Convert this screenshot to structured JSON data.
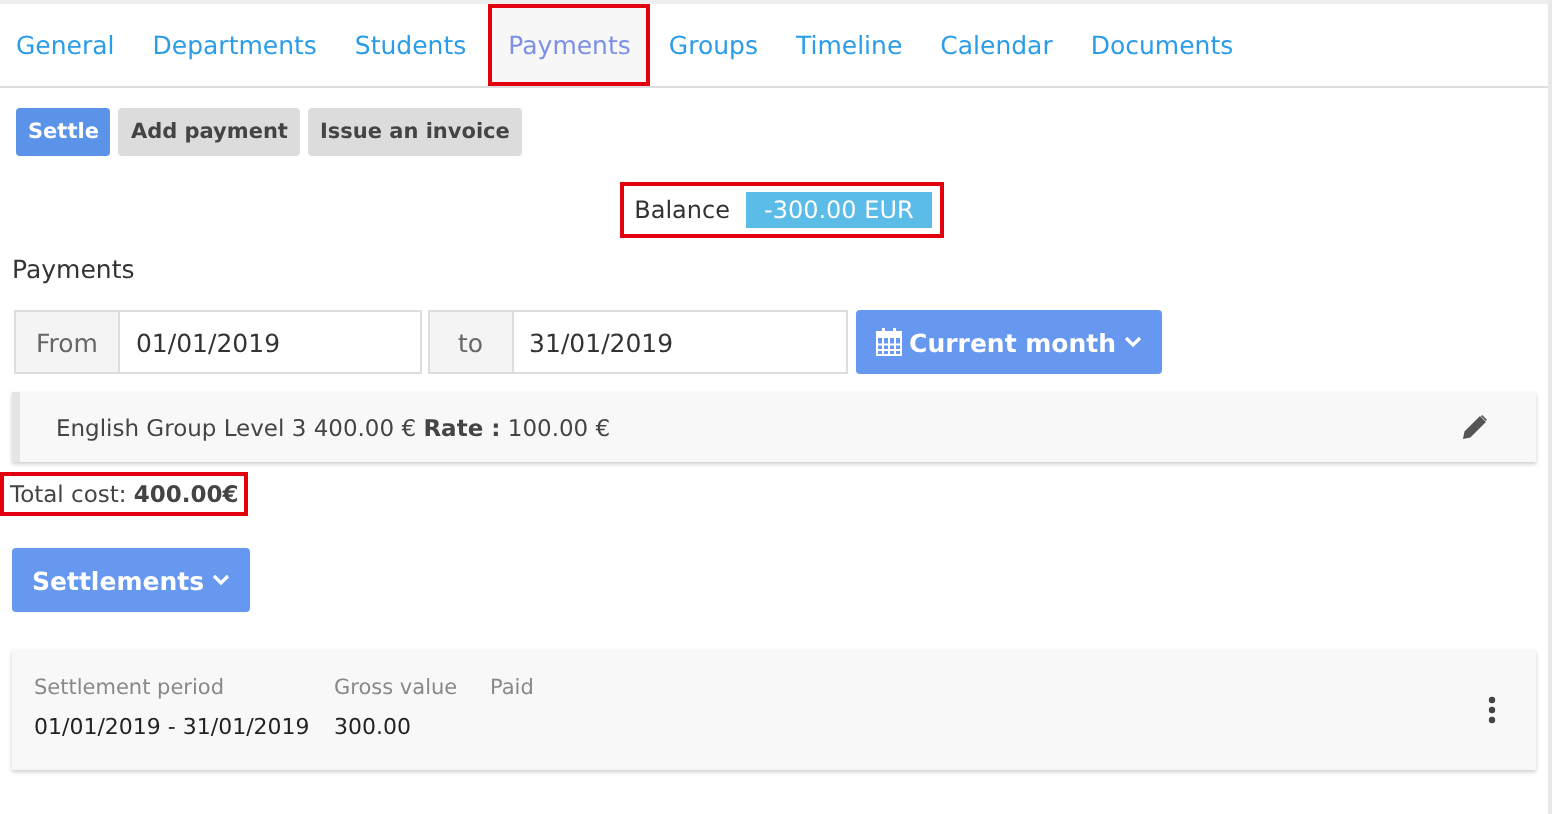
{
  "tabs": [
    {
      "label": "General",
      "selected": false,
      "highlighted": false
    },
    {
      "label": "Departments",
      "selected": false,
      "highlighted": false
    },
    {
      "label": "Students",
      "selected": false,
      "highlighted": false
    },
    {
      "label": "Payments",
      "selected": true,
      "highlighted": true
    },
    {
      "label": "Groups",
      "selected": false,
      "highlighted": false
    },
    {
      "label": "Timeline",
      "selected": false,
      "highlighted": false
    },
    {
      "label": "Calendar",
      "selected": false,
      "highlighted": false
    },
    {
      "label": "Documents",
      "selected": false,
      "highlighted": false
    }
  ],
  "actions": [
    {
      "label": "Settle",
      "kind": "primary"
    },
    {
      "label": "Add payment",
      "kind": "default"
    },
    {
      "label": "Issue an invoice",
      "kind": "default"
    }
  ],
  "balance": {
    "label": "Balance",
    "value": "-300.00 EUR",
    "highlighted": true
  },
  "section_title": "Payments",
  "date_filter": {
    "from_label": "From",
    "from_value": "01/01/2019",
    "to_label": "to",
    "to_value": "31/01/2019",
    "period_button": "Current month"
  },
  "payment_items": [
    {
      "text": "English Group Level 3 400.00 €",
      "rate_label": "Rate :",
      "rate_value": "100.00 €"
    }
  ],
  "total_cost": {
    "label": "Total cost:",
    "value": "400.00€",
    "highlighted": true
  },
  "settlements_button": "Settlements",
  "settlements": [
    {
      "period_label": "Settlement period",
      "period": "01/01/2019 - 31/01/2019",
      "gross_label": "Gross value",
      "gross": "300.00",
      "paid_label": "Paid"
    }
  ]
}
